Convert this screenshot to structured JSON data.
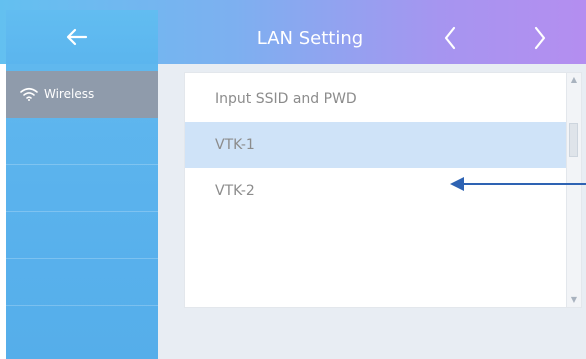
{
  "header": {
    "title": "LAN Setting",
    "back_icon": "arrow-left",
    "prev_icon": "chevron-left",
    "next_icon": "chevron-right"
  },
  "sidebar": {
    "items": [
      {
        "label": "Wireless",
        "icon": "wifi-icon",
        "active": true
      },
      {
        "label": ""
      },
      {
        "label": ""
      },
      {
        "label": ""
      },
      {
        "label": ""
      }
    ]
  },
  "networks": {
    "rows": [
      {
        "label": "Input SSID and PWD",
        "selected": false
      },
      {
        "label": "VTK-1",
        "selected": true
      },
      {
        "label": "VTK-2",
        "selected": false
      }
    ]
  },
  "annotation": {
    "arrow_color": "#2e63b3",
    "points_to": "VTK-2"
  },
  "colors": {
    "header_gradient_start": "#63c0f0",
    "header_gradient_end": "#b48ef0",
    "sidebar_bg": "#5ab2ed",
    "sidebar_active_bg": "#8f9bab",
    "selected_row_bg": "#cfe3f8",
    "row_text": "#8c8c8c"
  }
}
